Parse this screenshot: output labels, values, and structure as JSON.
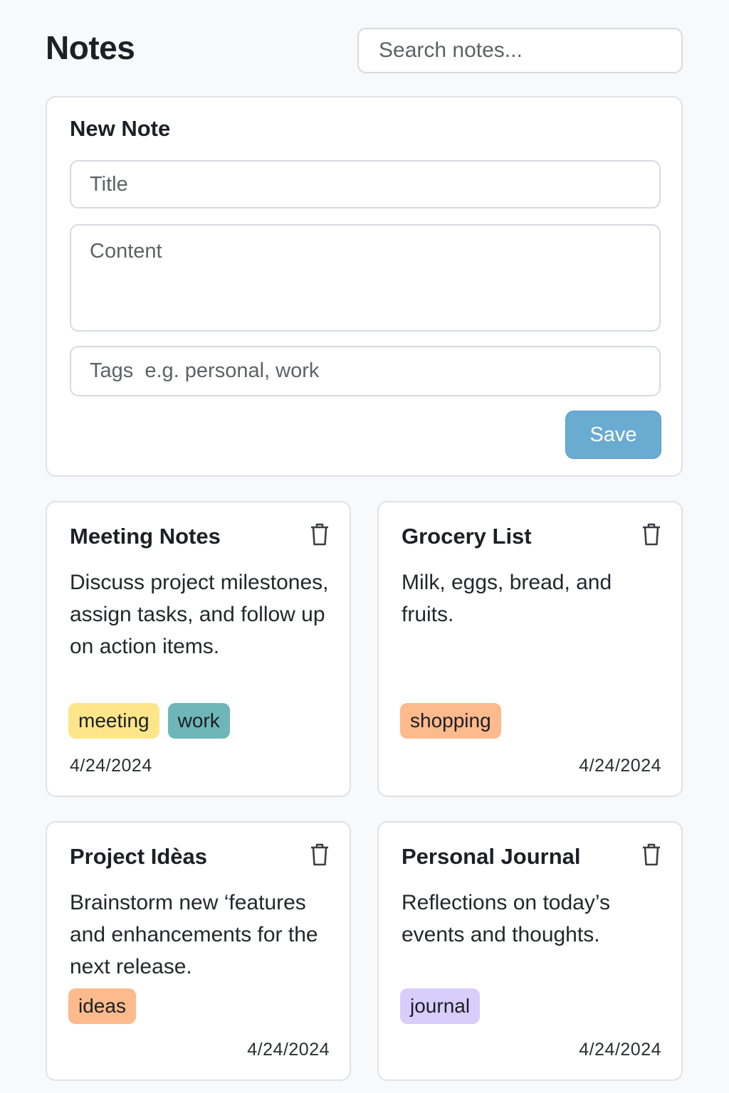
{
  "header": {
    "title": "Notes",
    "search_placeholder": "Search notes..."
  },
  "new_note": {
    "heading": "New Note",
    "title_placeholder": "Title",
    "content_placeholder": "Content",
    "tags_placeholder": "Tags  e.g. personal, work",
    "save_label": "Save",
    "save_color": "#6aabd2"
  },
  "notes": [
    {
      "title": "Meeting Notes",
      "body": "Discuss project milestones, assign tasks, and follow up on action items.",
      "tags": [
        {
          "label": "meeting",
          "color": "#fde68a"
        },
        {
          "label": "work",
          "color": "#6fb6b8"
        }
      ],
      "date": "4/24/2024",
      "delete_icon": "trash-icon"
    },
    {
      "title": "Grocery List",
      "body": "Milk, eggs, bread, and fruits.",
      "tags": [
        {
          "label": "shopping",
          "color": "#fdba8c"
        }
      ],
      "date": "4/24/2024",
      "delete_icon": "trash-icon"
    },
    {
      "title": "Project Idèas",
      "body": "Brainstorm new ‘features and enhancements for the next release.",
      "tags": [
        {
          "label": "ideas",
          "color": "#fdba8c"
        }
      ],
      "date": "4/24/2024",
      "delete_icon": "trash-icon"
    },
    {
      "title": "Personal Journal",
      "body": "Reflections on today’s events and thoughts.",
      "tags": [
        {
          "label": "journal",
          "color": "#d8cdfb"
        }
      ],
      "date": "4/24/2024",
      "delete_icon": "trash-icon"
    }
  ]
}
